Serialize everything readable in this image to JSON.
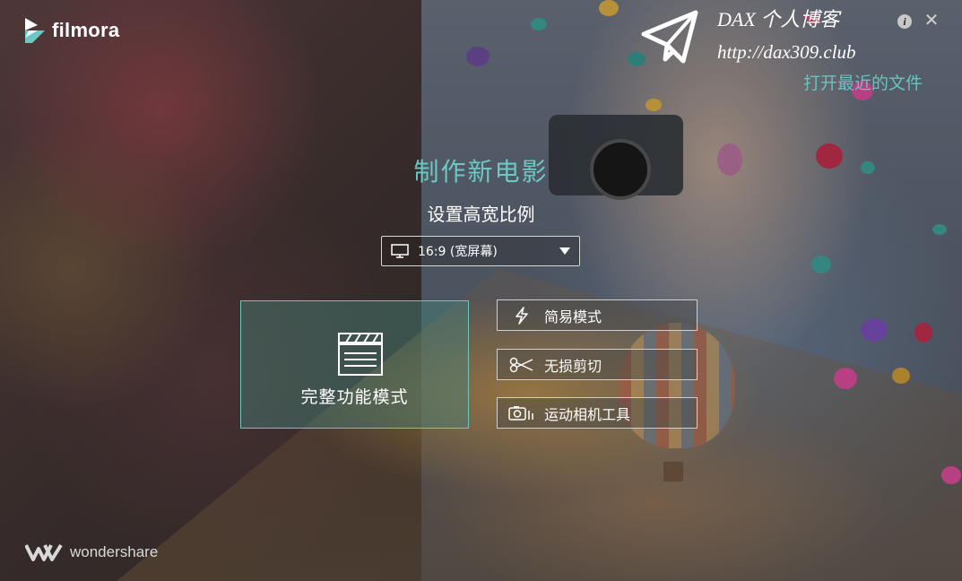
{
  "app": {
    "name": "filmora",
    "vendor": "wondershare"
  },
  "watermark": {
    "title": "DAX 个人博客",
    "url": "http://dax309.club"
  },
  "header": {
    "recent_files": "打开最近的文件",
    "info_icon": "info-icon",
    "close_icon": "close-icon"
  },
  "main": {
    "title": "制作新电影",
    "ratio_label": "设置高宽比例",
    "ratio_value": "16:9 (宽屏幕)",
    "full_mode_label": "完整功能模式",
    "modes": [
      {
        "label": "简易模式",
        "icon": "lightning-icon"
      },
      {
        "label": "无损剪切",
        "icon": "scissors-icon"
      },
      {
        "label": "运动相机工具",
        "icon": "action-camera-icon"
      }
    ]
  },
  "colors": {
    "accent": "#6cc8c3",
    "border_light": "#cfcfcf"
  }
}
